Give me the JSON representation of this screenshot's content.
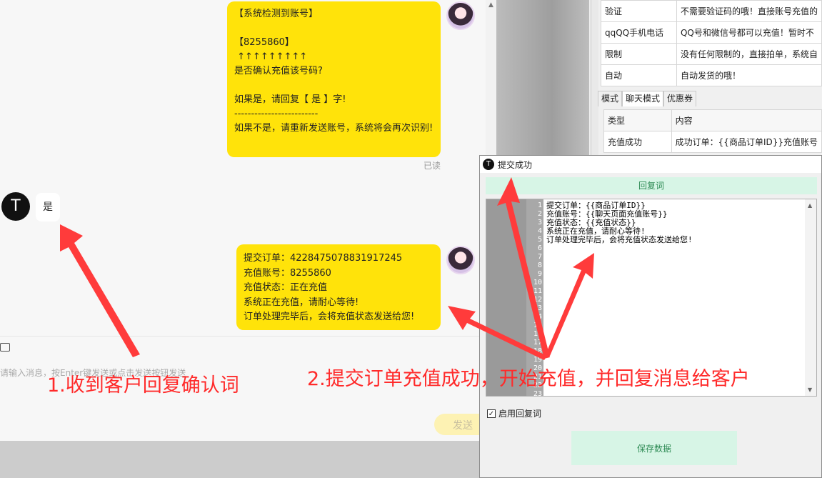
{
  "chat": {
    "bubble1_text": "【系统检测到账号】\n\n【8255860】\n ↑↑↑↑↑↑↑↑↑\n是否确认充值该号码?\n\n如果是，请回复【 是 】字!\n-------------------------\n如果不是，请重新发送账号，系统将会再次识别!",
    "read_status": "已读",
    "customer_avatar_letter": "T",
    "customer_reply": "是",
    "bubble3_text": "提交订单：4228475078831917245\n充值账号：8255860\n充值状态：正在充值\n系统正在充值，请耐心等待!\n订单处理完毕后，会将充值状态发送给您!",
    "input_placeholder": "请输入消息，按Enter键发送或点击发送按钮发送",
    "send_label": "发送"
  },
  "annotations": {
    "step1": "1.收到客户回复确认词",
    "step2": "2.提交订单充值成功，开始充值，并回复消息给客户"
  },
  "panel": {
    "table1": [
      {
        "type": "验证",
        "content": "不需要验证码的哦！直接账号充值的"
      },
      {
        "type": "qqQQ手机电话",
        "content": "QQ号和微信号都可以充值！暂时不"
      },
      {
        "type": "限制",
        "content": "没有任何限制的，直接拍单，系统自"
      },
      {
        "type": "自动",
        "content": "自动发货的哦！"
      }
    ],
    "tabs": [
      "模式",
      "聊天模式",
      "优惠券"
    ],
    "table2_header": {
      "type": "类型",
      "content": "内容"
    },
    "table2_rows": [
      {
        "type": "充值成功",
        "content": "成功订单：{{商品订单ID}}充值账号"
      }
    ]
  },
  "dialog": {
    "logo_letter": "T",
    "title": "提交成功",
    "reply_header": "回复词",
    "editor_text": "提交订单：{{商品订单ID}}\n充值账号：{{聊天页面充值账号}}\n充值状态：{{充值状态}}\n系统正在充值，请耐心等待!\n订单处理完毕后，会将充值状态发送给您!",
    "line_numbers": "1\n2\n3\n4\n5\n6\n7\n8\n9\n10\n11\n12\n13\n14\n15\n16\n17\n18\n19\n20\n21\n22\n23",
    "enable_label": "启用回复词",
    "enable_checked": "✓",
    "save_label": "保存数据"
  },
  "colors": {
    "bubble_yellow": "#ffe30a",
    "annotation_red": "#ff2a2a",
    "button_green_bg": "#d7f5e6"
  },
  "icons": [
    "image-icon",
    "scroll-up-icon",
    "scroll-down-icon",
    "check-icon"
  ]
}
